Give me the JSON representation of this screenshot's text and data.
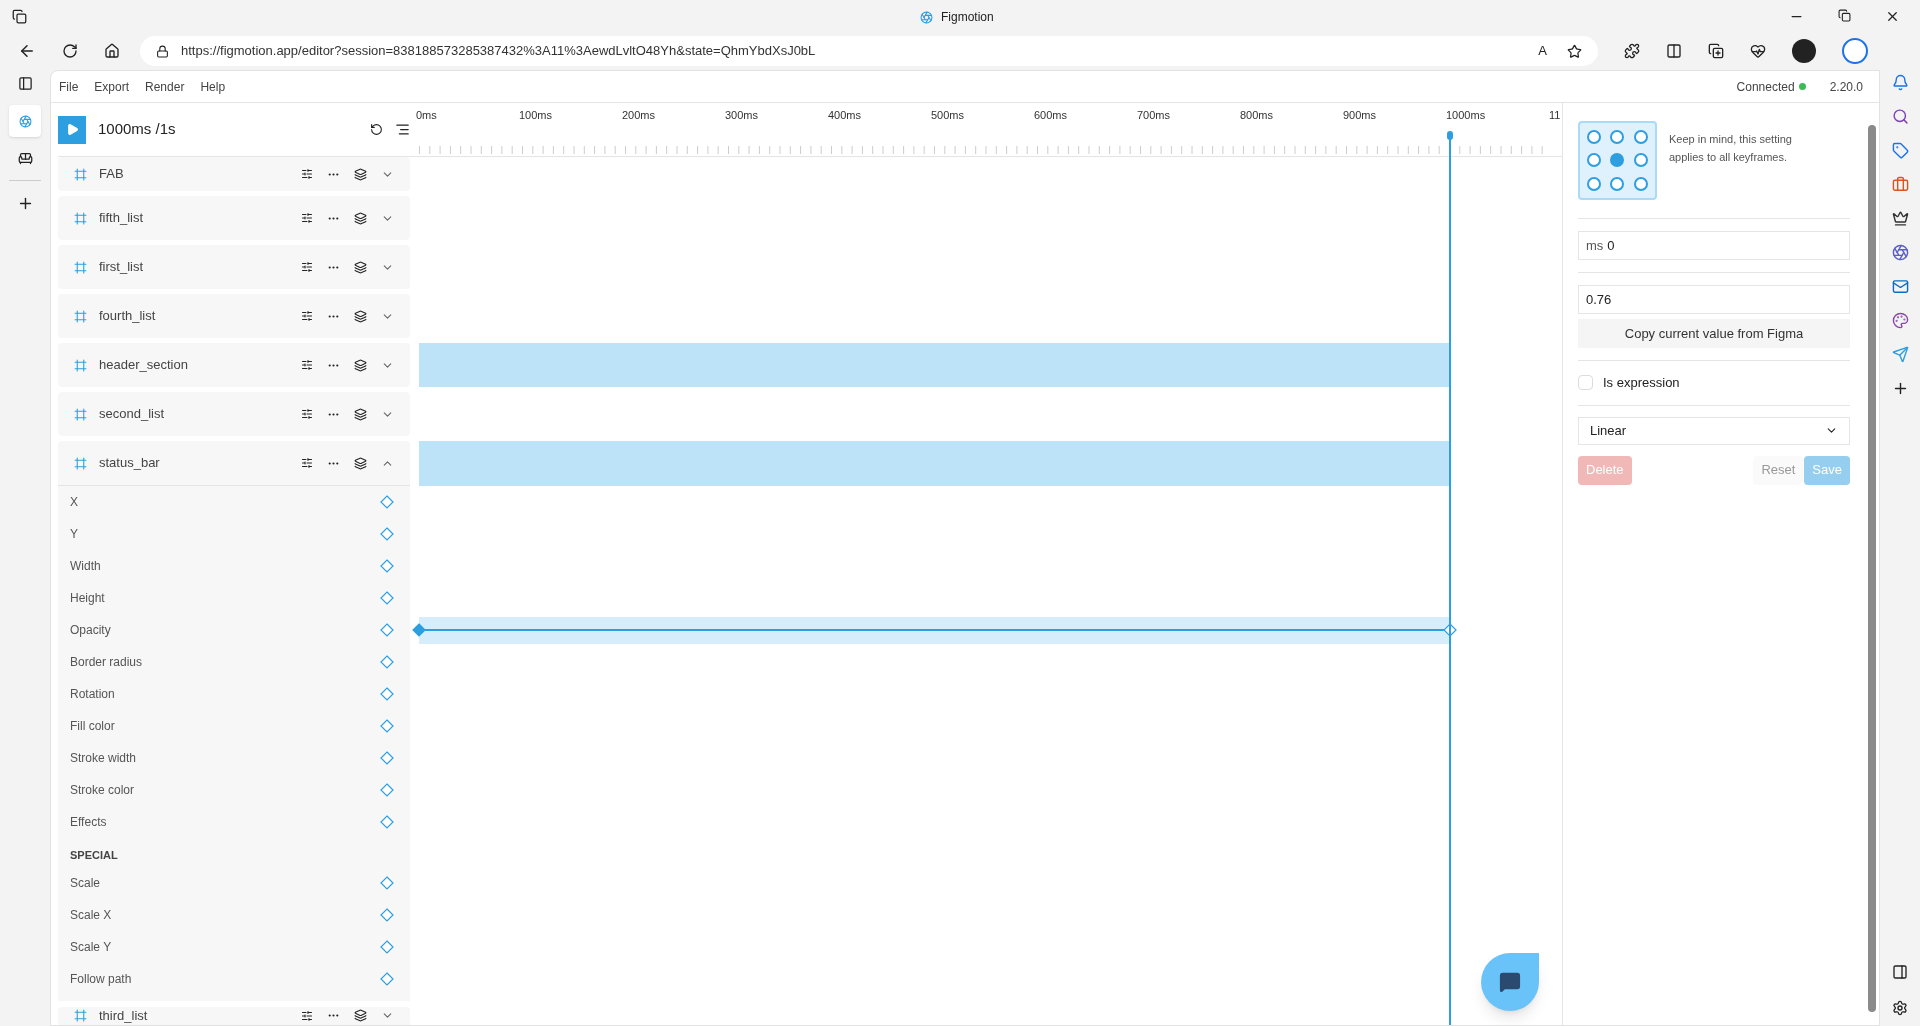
{
  "browser": {
    "title": "Figmotion",
    "url": "https://figmotion.app/editor?session=838188573285387432%3A11%3AewdLvltO48Yh&state=QhmYbdXsJ0bL",
    "read_aloud": "A"
  },
  "menu": [
    "File",
    "Export",
    "Render",
    "Help"
  ],
  "status": {
    "connection": "Connected",
    "connected": true,
    "version": "2.20.0"
  },
  "playback": {
    "time": "1000ms /1s"
  },
  "ruler": [
    "0ms",
    "100ms",
    "200ms",
    "300ms",
    "400ms",
    "500ms",
    "600ms",
    "700ms",
    "800ms",
    "900ms",
    "1000ms",
    "11"
  ],
  "layers": [
    {
      "name": "FAB",
      "expanded": false,
      "animated": false
    },
    {
      "name": "fifth_list",
      "expanded": false,
      "animated": false
    },
    {
      "name": "first_list",
      "expanded": false,
      "animated": false
    },
    {
      "name": "fourth_list",
      "expanded": false,
      "animated": false
    },
    {
      "name": "header_section",
      "expanded": false,
      "animated": true
    },
    {
      "name": "second_list",
      "expanded": false,
      "animated": false
    },
    {
      "name": "status_bar",
      "expanded": true,
      "animated": true,
      "properties": [
        {
          "label": "X",
          "animated": false
        },
        {
          "label": "Y",
          "animated": false
        },
        {
          "label": "Width",
          "animated": false
        },
        {
          "label": "Height",
          "animated": false
        },
        {
          "label": "Opacity",
          "animated": true
        },
        {
          "label": "Border radius",
          "animated": false
        },
        {
          "label": "Rotation",
          "animated": false
        },
        {
          "label": "Fill color",
          "animated": false
        },
        {
          "label": "Stroke width",
          "animated": false
        },
        {
          "label": "Stroke color",
          "animated": false
        },
        {
          "label": "Effects",
          "animated": false
        }
      ],
      "special_heading": "SPECIAL",
      "special": [
        {
          "label": "Scale",
          "animated": false
        },
        {
          "label": "Scale X",
          "animated": false
        },
        {
          "label": "Scale Y",
          "animated": false
        },
        {
          "label": "Follow path",
          "animated": false
        }
      ]
    },
    {
      "name": "third_list",
      "expanded": false,
      "animated": false
    }
  ],
  "panel": {
    "anchors": [
      {
        "selected": false
      },
      {
        "selected": false
      },
      {
        "selected": false
      },
      {
        "selected": false
      },
      {
        "selected": true
      },
      {
        "selected": false
      },
      {
        "selected": false
      },
      {
        "selected": false
      },
      {
        "selected": false
      }
    ],
    "hint": "Keep in mind, this setting applies to all keyframes.",
    "time_field": {
      "unit": "ms",
      "value": "0"
    },
    "value_field": {
      "value": "0.76"
    },
    "copy_button": "Copy current value from Figma",
    "expression": {
      "label": "Is expression",
      "checked": false
    },
    "easing": {
      "value": "Linear"
    },
    "actions": [
      {
        "label": "Delete",
        "kind": "danger",
        "disabled": true
      },
      {
        "label": "Reset",
        "kind": "plain",
        "disabled": false
      },
      {
        "label": "Save",
        "kind": "primary",
        "disabled": true
      }
    ]
  }
}
